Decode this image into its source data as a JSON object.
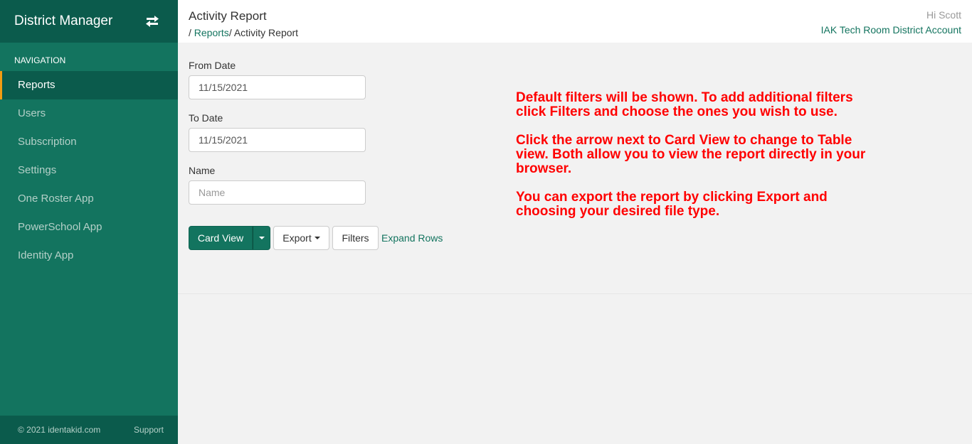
{
  "sidebar": {
    "brand": "District Manager",
    "switch_icon": "swap-arrows-icon",
    "nav_heading": "NAVIGATION",
    "items": [
      {
        "label": "Reports",
        "active": true
      },
      {
        "label": "Users",
        "active": false
      },
      {
        "label": "Subscription",
        "active": false
      },
      {
        "label": "Settings",
        "active": false
      },
      {
        "label": "One Roster App",
        "active": false
      },
      {
        "label": "PowerSchool App",
        "active": false
      },
      {
        "label": "Identity App",
        "active": false
      }
    ],
    "footer": {
      "copyright": "© 2021 identakid.com",
      "support": "Support"
    }
  },
  "header": {
    "title": "Activity Report",
    "breadcrumb": {
      "prefix": "/ ",
      "link": "Reports",
      "current": "/ Activity Report"
    },
    "greeting": "Hi Scott",
    "account": "IAK Tech Room District Account"
  },
  "filters": {
    "from_date": {
      "label": "From Date",
      "value": "11/15/2021"
    },
    "to_date": {
      "label": "To Date",
      "value": "11/15/2021"
    },
    "name": {
      "label": "Name",
      "value": "",
      "placeholder": "Name"
    }
  },
  "toolbar": {
    "card_view": "Card View",
    "export": "Export",
    "filters": "Filters",
    "expand_rows": "Expand Rows"
  },
  "help": [
    "Default filters will be shown. To add additional filters click Filters and choose the ones you wish to use.",
    "Click the arrow next to Card View to change to Table view. Both allow you to view the report directly in your browser.",
    "You can export the report by clicking Export and choosing your desired file type."
  ],
  "colors": {
    "brand_dark": "#0b5b4c",
    "brand": "#13745f",
    "active_indicator": "#f39c12",
    "help_text": "#ff0000"
  }
}
